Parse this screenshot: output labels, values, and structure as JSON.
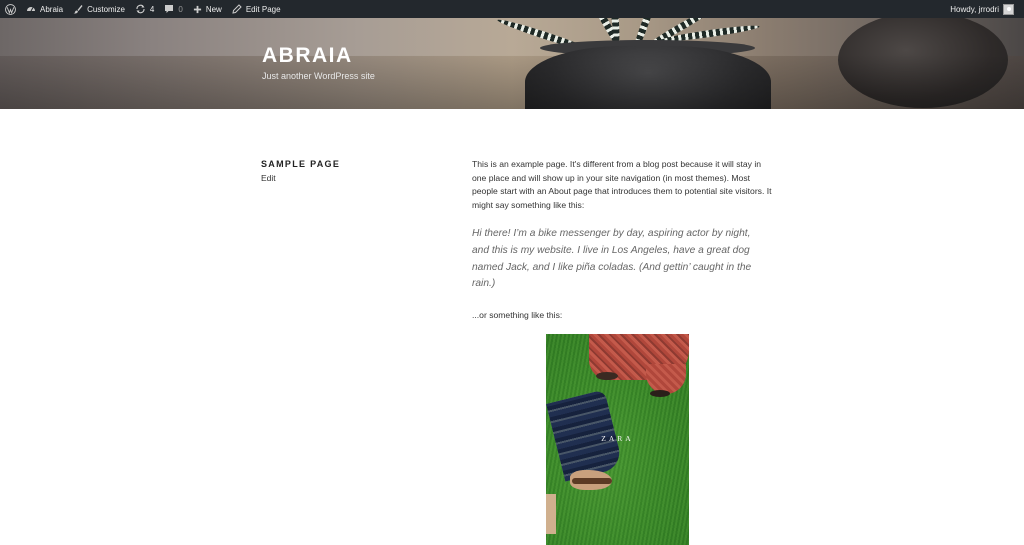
{
  "admin_bar": {
    "site_name": "Abraia",
    "customize": "Customize",
    "updates_count": "4",
    "comments_count": "0",
    "new": "New",
    "edit_page": "Edit Page",
    "greeting": "Howdy, jrrodri"
  },
  "header": {
    "title": "ABRAIA",
    "description": "Just another WordPress site"
  },
  "page": {
    "title": "SAMPLE PAGE",
    "edit": "Edit",
    "intro": "This is an example page. It's different from a blog post because it will stay in one place and will show up in your site navigation (in most themes). Most people start with an About page that introduces them to potential site visitors. It might say something like this:",
    "quote": "Hi there! I’m a bike messenger by day, aspiring actor by night, and this is my website. I live in Los Angeles, have a great dog named Jack, and I like piña coladas. (And gettin’ caught in the rain.)",
    "or_something": "...or something like this:",
    "image_brand": "ZARA"
  },
  "icons": {
    "wp": "wordpress-icon",
    "customize": "paintbrush-icon",
    "updates": "refresh-icon",
    "comments": "comment-icon",
    "new": "plus-icon",
    "edit": "pencil-icon",
    "site": "dashboard-icon"
  },
  "colors": {
    "admin_bar": "#23282d",
    "text": "#333333",
    "quote": "#666666"
  }
}
